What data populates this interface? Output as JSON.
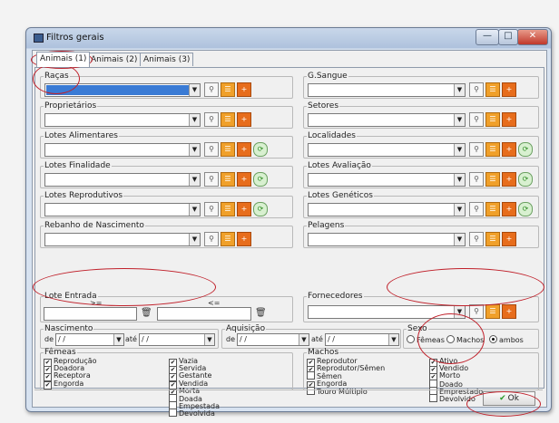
{
  "window": {
    "title": "Filtros gerais",
    "minimize_icon": "minimize-icon",
    "maximize_icon": "maximize-icon",
    "close_icon": "close-icon"
  },
  "tabs": [
    {
      "label": "Animais (1)",
      "active": true
    },
    {
      "label": "Animais (2)",
      "active": false
    },
    {
      "label": "Animais (3)",
      "active": false
    }
  ],
  "left_groups": [
    {
      "legend": "Raças",
      "refresh": false,
      "selected": true
    },
    {
      "legend": "Proprietários",
      "refresh": false,
      "selected": false
    },
    {
      "legend": "Lotes Alimentares",
      "refresh": true,
      "selected": false
    },
    {
      "legend": "Lotes Finalidade",
      "refresh": true,
      "selected": false
    },
    {
      "legend": "Lotes Reprodutivos",
      "refresh": true,
      "selected": false
    },
    {
      "legend": "Rebanho de Nascimento",
      "refresh": false,
      "selected": false
    }
  ],
  "right_groups": [
    {
      "legend": "G.Sangue",
      "refresh": false
    },
    {
      "legend": "Setores",
      "refresh": false
    },
    {
      "legend": "Localidades",
      "refresh": true
    },
    {
      "legend": "Lotes Avaliação",
      "refresh": true
    },
    {
      "legend": "Lotes Genéticos",
      "refresh": true
    },
    {
      "legend": "Pelagens",
      "refresh": false
    }
  ],
  "lote_entrada": {
    "legend": "Lote Entrada",
    "from_label": ">=",
    "to_label": "<="
  },
  "fornecedores": {
    "legend": "Fornecedores"
  },
  "nascimento": {
    "legend": "Nascimento",
    "de_label": "de",
    "ate_label": "até",
    "de_value": " / /",
    "ate_value": " / /"
  },
  "aquisicao": {
    "legend": "Aquisição",
    "de_label": "de",
    "ate_label": "até",
    "de_value": " / /",
    "ate_value": " / /"
  },
  "sexo": {
    "legend": "Sexo",
    "options": [
      {
        "label": "Fêmeas",
        "selected": false
      },
      {
        "label": "Machos",
        "selected": false
      },
      {
        "label": "ambos",
        "selected": true
      }
    ]
  },
  "femeas": {
    "legend": "Fêmeas",
    "col1": [
      {
        "label": "Reprodução",
        "checked": true
      },
      {
        "label": "Doadora",
        "checked": true
      },
      {
        "label": "Receptora",
        "checked": true
      },
      {
        "label": "Engorda",
        "checked": true
      }
    ],
    "col2": [
      {
        "label": "Vazia",
        "checked": true
      },
      {
        "label": "Servida",
        "checked": true
      },
      {
        "label": "Gestante",
        "checked": true
      },
      {
        "label": "Vendida",
        "checked": true
      },
      {
        "label": "Morta",
        "checked": true
      },
      {
        "label": "Doada",
        "checked": false
      },
      {
        "label": "Empestada",
        "checked": false
      },
      {
        "label": "Devolvida",
        "checked": false
      }
    ]
  },
  "machos": {
    "legend": "Machos",
    "col1": [
      {
        "label": "Reprodutor",
        "checked": true
      },
      {
        "label": "Reprodutor/Sêmen",
        "checked": true
      },
      {
        "label": "Sêmen",
        "checked": false
      },
      {
        "label": "Engorda",
        "checked": true
      },
      {
        "label": "Touro Múltiplo",
        "checked": false
      }
    ],
    "col2": [
      {
        "label": "Ativo",
        "checked": true
      },
      {
        "label": "Vendido",
        "checked": true
      },
      {
        "label": "Morto",
        "checked": true
      },
      {
        "label": "Doado",
        "checked": false
      },
      {
        "label": "Emprestado",
        "checked": false
      },
      {
        "label": "Devolvido",
        "checked": false
      }
    ]
  },
  "ok_button": {
    "label": "Ok",
    "icon": "checkmark-icon"
  },
  "colors": {
    "selection": "#3a7bd5",
    "annotation": "#c0202a",
    "list_button": "#f0a02a",
    "add_button": "#e76d1c"
  }
}
